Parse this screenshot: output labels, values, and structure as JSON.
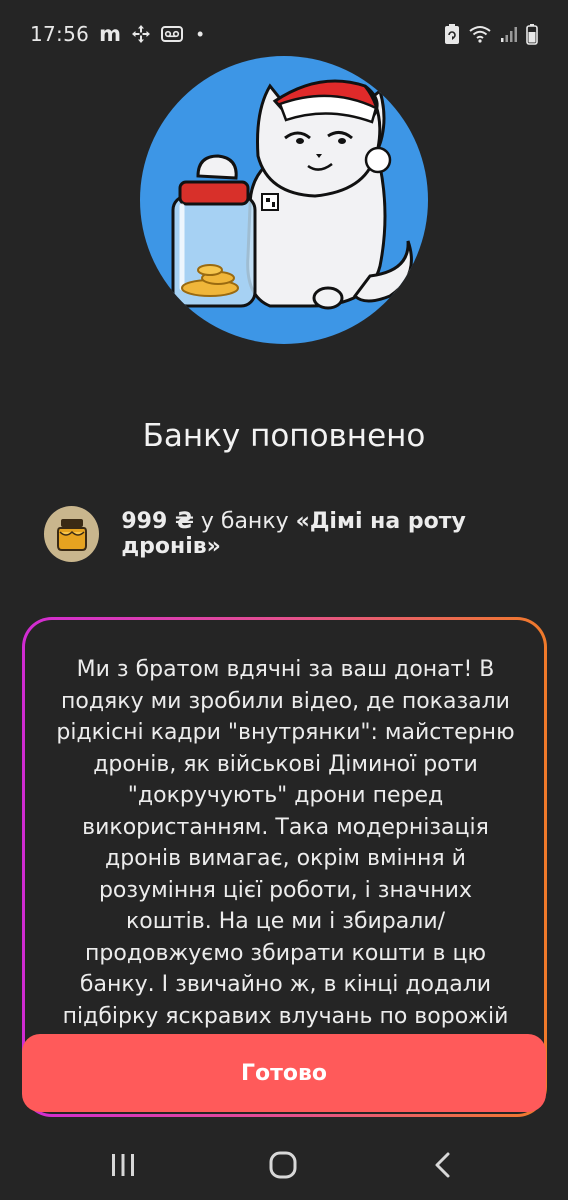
{
  "status_bar": {
    "time": "17:56",
    "app_letter": "m",
    "icons": [
      "move-icon",
      "voicemail-icon",
      "dot-icon",
      "recycle-battery-saver-icon",
      "wifi-icon",
      "signal-icon",
      "battery-icon"
    ],
    "dot": "•"
  },
  "avatar": {
    "icon": "cat-with-jar-santa-hat-illustration",
    "background": "#3d96e6"
  },
  "title": "Банку поповнено",
  "bank_info": {
    "icon": "honey-jar-icon",
    "amount": "999 ₴",
    "preposition": " у банку ",
    "jar_name": "«Дімі на роту дронів»"
  },
  "message": {
    "text": "Ми з братом вдячні за ваш донат! В подяку ми зробили відео, де показали рідкісні кадри  \"внутрянки\": майстерню дронів, як військові Діминої роти \"докручують\" дрони перед використанням. Така модернізація дронів вимагає, окрім вміння й розуміння цієї роботи, і значних коштів. На це ми і збирали/продовжуємо збирати кошти в цю банку. І звичайно ж, в кінці додали підбірку яскравих влучань по ворожій техніці нашими вправними пілотами. Перейдіть за"
  },
  "done_button": {
    "label": "Готово",
    "color": "#ff5a5a"
  },
  "nav_bar": {
    "icons": [
      "recent-apps-icon",
      "home-icon",
      "back-icon"
    ]
  },
  "colors": {
    "background": "#252525",
    "gradient_start": "#d12bd3",
    "gradient_end": "#f07a2a"
  }
}
